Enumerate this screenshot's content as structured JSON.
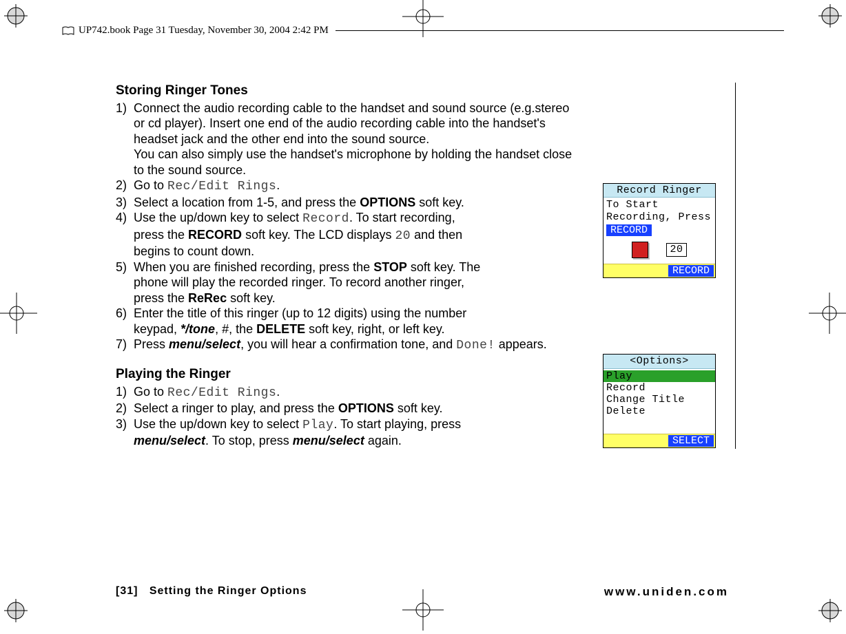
{
  "header": {
    "runner": "UP742.book  Page 31  Tuesday, November 30, 2004  2:42 PM"
  },
  "section1": {
    "heading": "Storing Ringer Tones",
    "steps": {
      "s1": {
        "num": "1)",
        "line1": "Connect the audio recording cable to the handset and sound source (e.g.stereo",
        "line2": "or cd player). Insert one end of the audio recording cable into the handset's",
        "line3": "headset jack and the other end into the sound source.",
        "line4": "You can also simply use the handset's microphone by holding the handset close",
        "line5": "to the sound source."
      },
      "s2": {
        "num": "2)",
        "pre": "Go to ",
        "lcd": "Rec/Edit Rings",
        "post": "."
      },
      "s3": {
        "num": "3)",
        "pre": "Select a location from 1-5, and press the ",
        "bold": "OPTIONS",
        "post": " soft key."
      },
      "s4": {
        "num": "4)",
        "p1a": "Use the up/down key to select ",
        "p1lcd": "Record",
        "p1b": ". To start recording,",
        "p2a": "press the ",
        "p2bold": "RECORD",
        "p2b": " soft key. The LCD displays ",
        "p2lcd": "20",
        "p2c": " and then",
        "p3": "begins to count down."
      },
      "s5": {
        "num": "5)",
        "p1a": "When you are finished recording, press the ",
        "p1bold": "STOP",
        "p1b": " soft key. The",
        "p2": "phone will play the recorded ringer. To record another ringer,",
        "p3a": "press the ",
        "p3bold": "ReRec",
        "p3b": " soft key."
      },
      "s6": {
        "num": "6)",
        "p1": "Enter the title of this ringer (up to 12 digits) using the number",
        "p2a": "keypad, ",
        "p2b1": "*/tone",
        "p2b2": ", #, the ",
        "p2bold": "DELETE",
        "p2c": " soft key, right, or left key."
      },
      "s7": {
        "num": "7)",
        "p1a": "Press ",
        "p1b": "menu/select",
        "p1c": ", you will hear a confirmation tone, and ",
        "p1lcd": "Done!",
        "p1d": " appears."
      }
    }
  },
  "section2": {
    "heading": "Playing the Ringer",
    "steps": {
      "s1": {
        "num": "1)",
        "pre": "Go to ",
        "lcd": "Rec/Edit Rings",
        "post": "."
      },
      "s2": {
        "num": "2)",
        "pre": "Select a ringer to play, and press the ",
        "bold": "OPTIONS",
        "post": " soft key."
      },
      "s3": {
        "num": "3)",
        "p1a": "Use the up/down key to select ",
        "p1lcd": "Play",
        "p1b": ". To start playing, press",
        "p2a": "menu/select",
        "p2b": ". To stop, press ",
        "p2c": "menu/select",
        "p2d": " again."
      }
    }
  },
  "lcd1": {
    "title": "Record Ringer",
    "line1": "To Start",
    "line2": "Recording, Press",
    "pill": "RECORD",
    "count": "20",
    "footer_btn": "RECORD"
  },
  "lcd2": {
    "title": "<Options>",
    "items": {
      "i0": "Play",
      "i1": "Record",
      "i2": "Change Title",
      "i3": "Delete"
    },
    "footer_btn": "SELECT"
  },
  "footer": {
    "page_num": "[31]",
    "section": "Setting the Ringer Options",
    "url": "www.uniden.com"
  }
}
